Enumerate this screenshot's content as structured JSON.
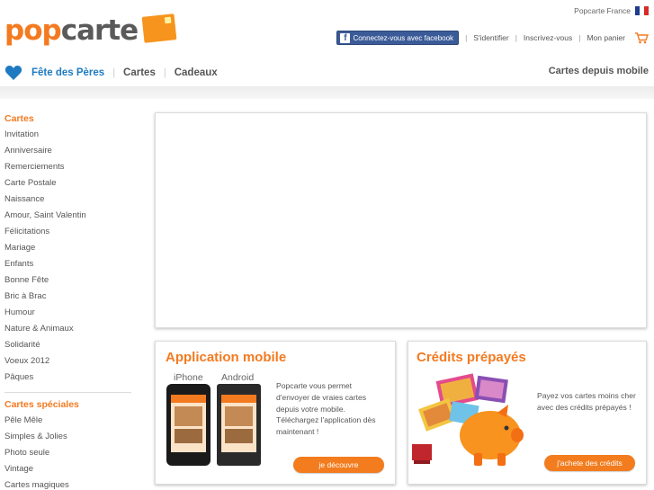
{
  "header": {
    "logo": {
      "pop": "pop",
      "carte": "carte"
    },
    "locale": "Popcarte France",
    "facebook_button": "Connectez-vous avec facebook",
    "login": "S'identifier",
    "register": "Inscrivez-vous",
    "cart": "Mon panier"
  },
  "nav": {
    "items": [
      "Fête des Pères",
      "Cartes",
      "Cadeaux"
    ],
    "mobile_link": "Cartes depuis mobile"
  },
  "sidebar": {
    "cartes_title": "Cartes",
    "cartes": [
      "Invitation",
      "Anniversaire",
      "Remerciements",
      "Carte Postale",
      "Naissance",
      "Amour, Saint Valentin",
      "Félicitations",
      "Mariage",
      "Enfants",
      "Bonne Fête",
      "Bric à Brac",
      "Humour",
      "Nature & Animaux",
      "Solidarité",
      "Voeux 2012",
      "Pâques"
    ],
    "speciales_title": "Cartes spéciales",
    "speciales": [
      "Pêle Mêle",
      "Simples & Jolies",
      "Photo seule",
      "Vintage",
      "Cartes magiques"
    ]
  },
  "app_box": {
    "title": "Application mobile",
    "iphone_label": "iPhone",
    "android_label": "Android",
    "text": "Popcarte vous permet d'envoyer de vraies cartes depuis votre mobile. Téléchargez l'application dès maintenant !",
    "button": "je découvre"
  },
  "credits_box": {
    "title": "Crédits prépayés",
    "text": "Payez vos cartes moins cher avec des crédits prépayés !",
    "button": "j'achete des crédits"
  },
  "colors": {
    "accent": "#f47a20",
    "nav_active": "#1e7ac0",
    "facebook": "#3b5b98"
  },
  "icons": [
    "heart-icon",
    "cart-icon",
    "facebook-icon",
    "flag-icon",
    "piggy-bank-icon"
  ]
}
